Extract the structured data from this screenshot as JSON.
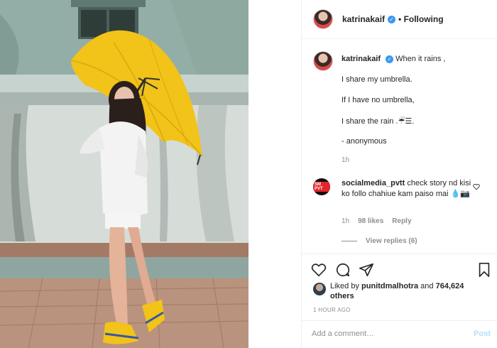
{
  "post": {
    "username": "katrinakaif",
    "verified_icon": "verified-badge-icon",
    "following_label": "• Following"
  },
  "caption": {
    "username": "katrinakaif",
    "first_line": "When it rains ,",
    "lines": [
      "I share my umbrella.",
      "If I have no umbrella,",
      "I share the rain .☔︎☰.",
      "- anonymous"
    ],
    "time": "1h"
  },
  "comment": {
    "avatar_text": "SM PVT",
    "username": "socialmedia_pvtt",
    "text": "check story nd kisi ko follo chahiue kam paiso mai 💧📷",
    "time": "1h",
    "likes": "98 likes",
    "reply_label": "Reply",
    "view_replies": "View replies (6)"
  },
  "actions": {
    "icons": [
      "heart-icon",
      "comment-icon",
      "share-icon",
      "bookmark-icon"
    ]
  },
  "likes": {
    "prefix": "Liked by",
    "user": "punitdmalhotra",
    "and": "and",
    "count": "764,624 others"
  },
  "timestamp": "1 HOUR AGO",
  "add_comment": {
    "placeholder": "Add a comment…",
    "post_label": "Post"
  },
  "colors": {
    "accent": "#3897f0",
    "post_disabled": "#b2dffc",
    "umbrella": "#f2c318",
    "muted_text": "#8e8e8e"
  }
}
